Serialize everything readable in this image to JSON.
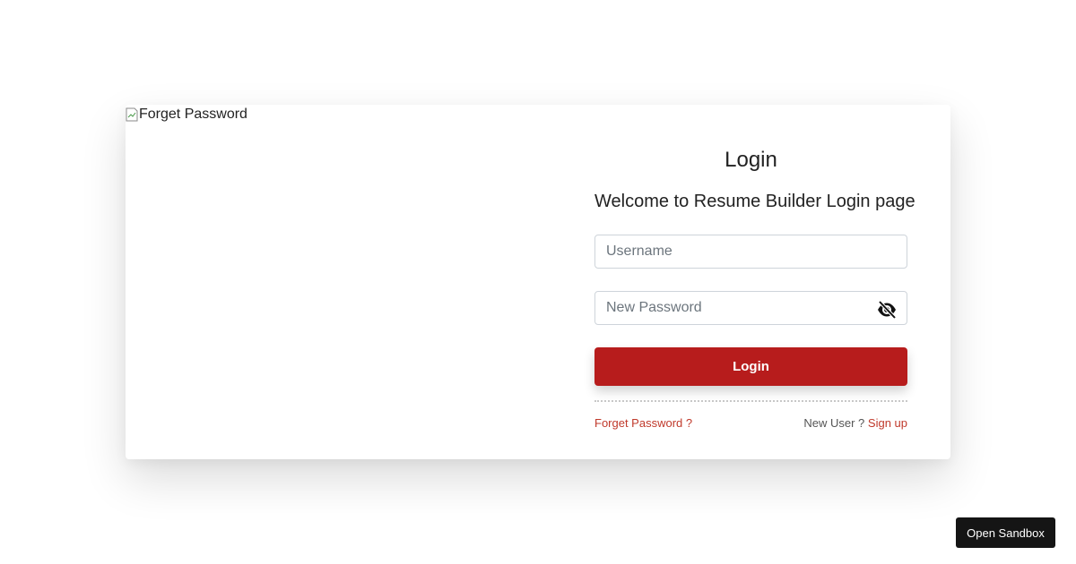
{
  "image_alt": "Forget Password",
  "form": {
    "title": "Login",
    "subtitle": "Welcome to Resume Builder Login page",
    "username_placeholder": "Username",
    "password_placeholder": "New Password",
    "password_toggle_icon": "eye-slash-icon",
    "login_label": "Login",
    "forgot_link": "Forget Password ?",
    "new_user_text": "New User ?",
    "signup_link": "Sign up"
  },
  "sandbox_button": "Open Sandbox",
  "colors": {
    "accent": "#b71c1c",
    "link": "#c0392b"
  }
}
